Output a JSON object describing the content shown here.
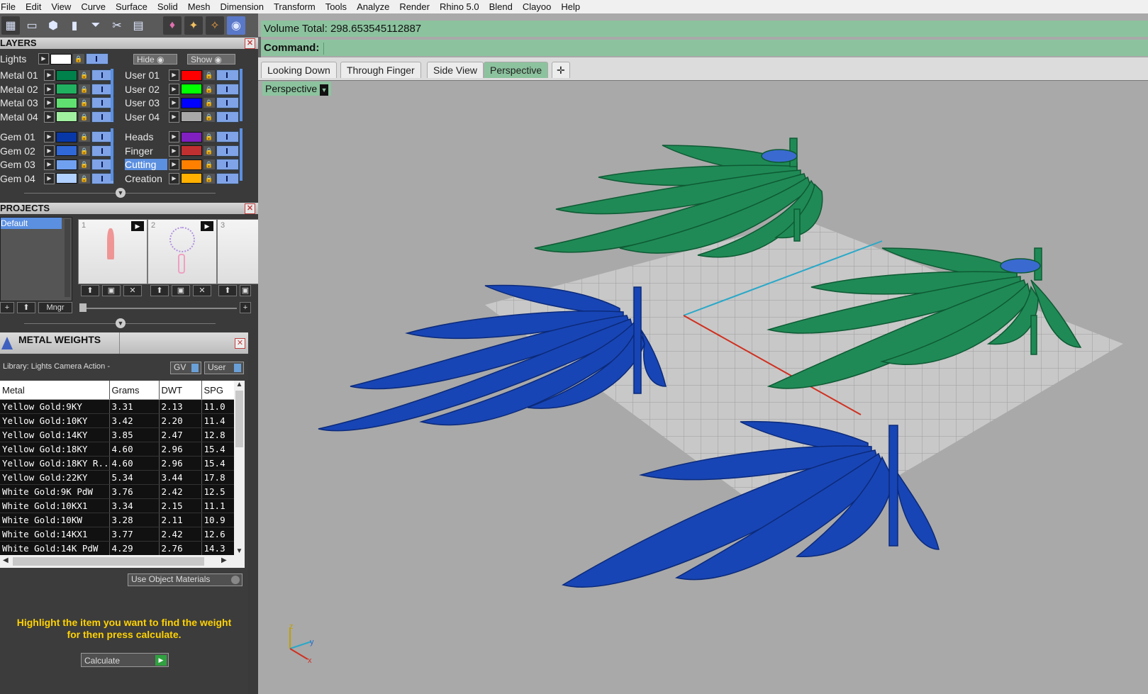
{
  "menu": [
    "File",
    "Edit",
    "View",
    "Curve",
    "Surface",
    "Solid",
    "Mesh",
    "Dimension",
    "Transform",
    "Tools",
    "Analyze",
    "Render",
    "Rhino 5.0",
    "Blend",
    "Clayoo",
    "Help"
  ],
  "command_area": {
    "volume_label": "Volume Total: 298.653545112887",
    "command_label": "Command:"
  },
  "tabs": [
    "Looking Down",
    "Through Finger",
    "Side View",
    "Perspective"
  ],
  "active_tab": "Perspective",
  "add_tab_icon": "plus-icon",
  "viewport_label": "Perspective",
  "layers": {
    "title": "LAYERS",
    "lights_label": "Lights",
    "hide_label": "Hide",
    "show_label": "Show",
    "left": [
      {
        "name": "Metal 01",
        "color": "#00804a"
      },
      {
        "name": "Metal 02",
        "color": "#20b060"
      },
      {
        "name": "Metal 03",
        "color": "#60e070"
      },
      {
        "name": "Metal 04",
        "color": "#a0f0a0"
      },
      {
        "name": "Gem 01",
        "color": "#0838a8"
      },
      {
        "name": "Gem 02",
        "color": "#3068d8"
      },
      {
        "name": "Gem 03",
        "color": "#70a0f0"
      },
      {
        "name": "Gem 04",
        "color": "#b0d0ff"
      }
    ],
    "right": [
      {
        "name": "User 01",
        "color": "#ff0000"
      },
      {
        "name": "User 02",
        "color": "#00ff00"
      },
      {
        "name": "User 03",
        "color": "#0000ff"
      },
      {
        "name": "User 04",
        "color": "#a8a8a8"
      },
      {
        "name": "Heads",
        "color": "#8020c0"
      },
      {
        "name": "Finger",
        "color": "#c03030"
      },
      {
        "name": "Cutting",
        "color": "#ff8000",
        "highlight": true
      },
      {
        "name": "Creation",
        "color": "#ffb000"
      }
    ]
  },
  "projects": {
    "title": "PROJECTS",
    "list": [
      "Default"
    ],
    "thumbs": [
      "1",
      "2",
      "3"
    ],
    "mngr_label": "Mngr"
  },
  "metal_weights": {
    "title": "METAL WEIGHTS",
    "library": "Library: Lights Camera Action -",
    "gv_label": "GV",
    "user_label": "User",
    "columns": [
      "Metal",
      "Grams",
      "DWT",
      "SPG"
    ],
    "rows": [
      [
        "Yellow Gold:9KY",
        "3.31",
        "2.13",
        "11.0"
      ],
      [
        "Yellow Gold:10KY",
        "3.42",
        "2.20",
        "11.4"
      ],
      [
        "Yellow Gold:14KY",
        "3.85",
        "2.47",
        "12.8"
      ],
      [
        "Yellow Gold:18KY",
        "4.60",
        "2.96",
        "15.4"
      ],
      [
        "Yellow Gold:18KY R...",
        "4.60",
        "2.96",
        "15.4"
      ],
      [
        "Yellow Gold:22KY",
        "5.34",
        "3.44",
        "17.8"
      ],
      [
        "White Gold:9K PdW",
        "3.76",
        "2.42",
        "12.5"
      ],
      [
        "White Gold:10KX1",
        "3.34",
        "2.15",
        "11.1"
      ],
      [
        "White Gold:10KW",
        "3.28",
        "2.11",
        "10.9"
      ],
      [
        "White Gold:14KX1",
        "3.77",
        "2.42",
        "12.6"
      ],
      [
        "White Gold:14K PdW",
        "4.29",
        "2.76",
        "14.3"
      ]
    ],
    "use_object_materials": "Use Object Materials",
    "note_line1": "Highlight the item you want to find the weight",
    "note_line2": "for then press calculate.",
    "calculate_label": "Calculate"
  },
  "axis_labels": {
    "x": "x",
    "y": "y",
    "z": "z"
  },
  "colors": {
    "green_model": "#1f8a55",
    "blue_model": "#1845b5",
    "status_green": "#8cc39e",
    "highlight": "#5b8fe0",
    "note_yellow": "#ffd200"
  }
}
